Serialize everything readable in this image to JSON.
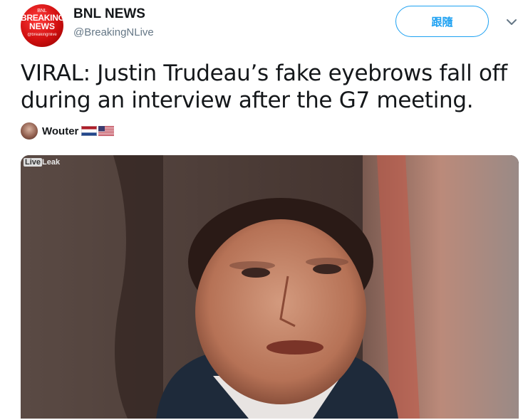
{
  "account": {
    "display_name": "BNL NEWS",
    "screen_name": "@BreakingNLive",
    "avatar_small": "BNL",
    "avatar_line1": "BREAKING",
    "avatar_line2": "NEWS",
    "avatar_handle": "@breakingnlive"
  },
  "follow_label": "跟隨",
  "tweet_text": "VIRAL: Justin Trudeau’s fake eyebrows fall off during an interview after the G7 meeting.",
  "mention": {
    "name": "Wouter",
    "flags": [
      "netherlands-flag",
      "usa-flag"
    ]
  },
  "media": {
    "watermark_live": "Live",
    "watermark_leak": "Leak"
  },
  "colors": {
    "accent": "#1da1f2",
    "secondary_text": "#657786",
    "text": "#14171a"
  }
}
